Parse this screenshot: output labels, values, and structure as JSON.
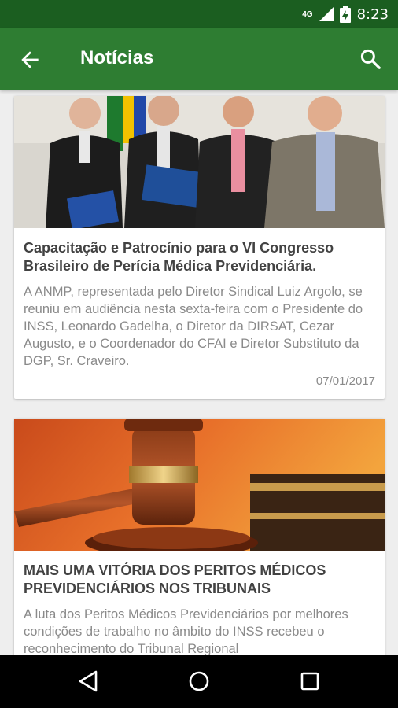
{
  "status_bar": {
    "network_label": "4G",
    "time": "8:23",
    "icons": [
      "signal-icon",
      "battery-icon"
    ]
  },
  "app_bar": {
    "title": "Notícias",
    "icons": [
      "back-arrow-icon",
      "search-icon"
    ],
    "color": "#2e7d32",
    "status_color": "#1b5e20"
  },
  "news": [
    {
      "image": "photo-four-men-holding-documents",
      "title": "Capacitação e Patrocínio para o VI Congresso Brasileiro de Perícia Médica Previdenciária.",
      "description": "A ANMP, representada pelo Diretor Sindical Luiz Argolo, se reuniu em audiência nesta sexta-feira com o Presidente do INSS, Leonardo Gadelha, o Diretor da DIRSAT, Cezar Augusto, e o Coordenador do CFAI e Diretor Substituto da DGP, Sr. Craveiro.",
      "date": "07/01/2017"
    },
    {
      "image": "photo-judge-gavel-and-books",
      "title": "MAIS UMA VITÓRIA DOS PERITOS MÉDICOS PREVIDENCIÁRIOS NOS TRIBUNAIS",
      "description": "A luta dos Peritos Médicos Previdenciários por melhores condições de trabalho no âmbito do INSS recebeu o reconhecimento do Tribunal Regional"
    }
  ],
  "nav_bar": {
    "icons": [
      "back-triangle-icon",
      "home-circle-icon",
      "recents-square-icon"
    ]
  }
}
